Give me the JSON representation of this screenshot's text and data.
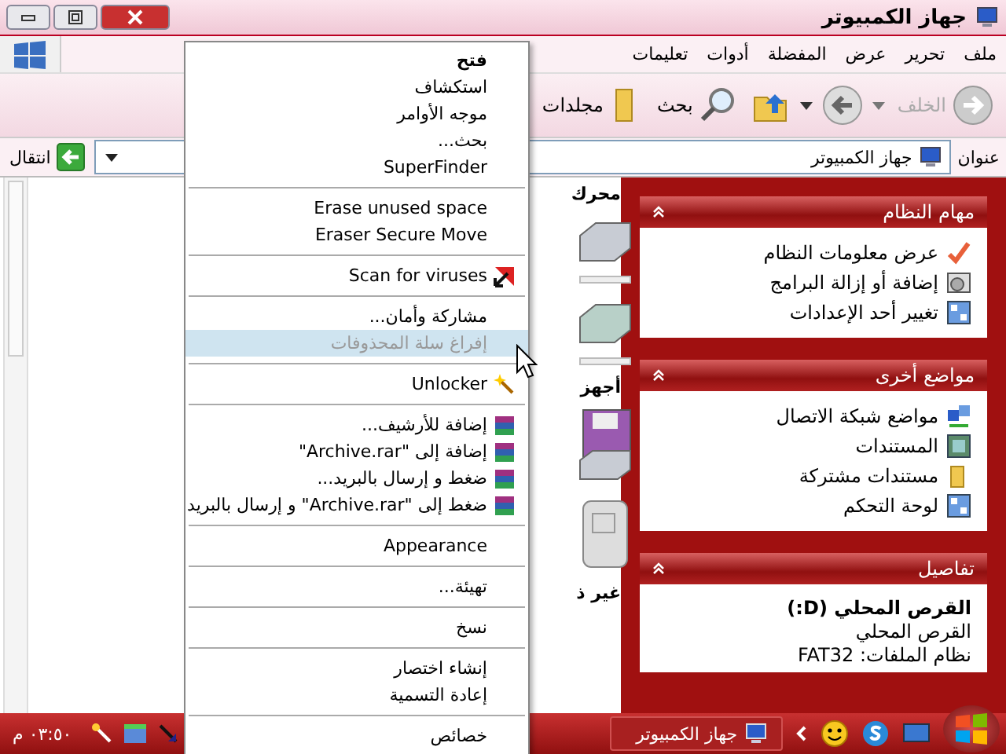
{
  "window": {
    "title": "جهاز الكمبيوتر"
  },
  "menu_bar": [
    "ملف",
    "تحرير",
    "عرض",
    "المفضلة",
    "أدوات",
    "تعليمات"
  ],
  "toolbar": {
    "back": {
      "label": "الخلف",
      "disabled": true
    },
    "search": "بحث",
    "folders": "مجلدات"
  },
  "address_bar": {
    "label": "عنوان",
    "value": "جهاز الكمبيوتر",
    "go": "انتقال"
  },
  "file_area": {
    "group_headers": [
      "محرك",
      "أجهز",
      "غير ذ"
    ]
  },
  "task_panels": [
    {
      "title": "مهام النظام",
      "expanded": true,
      "items": [
        "عرض معلومات النظام",
        "إضافة أو إزالة البرامج",
        "تغيير أحد الإعدادات"
      ]
    },
    {
      "title": "مواضع أخرى",
      "expanded": true,
      "items": [
        "مواضع شبكة الاتصال",
        "المستندات",
        "مستندات مشتركة",
        "لوحة التحكم"
      ]
    }
  ],
  "details": {
    "title": "تفاصيل",
    "expanded": true,
    "name": "القرص المحلي (D:)",
    "type": "القرص المحلي",
    "file_system": "نظام الملفات: FAT32"
  },
  "context_menu": [
    {
      "kind": "item",
      "label": "فتح",
      "default": true,
      "disabled": false,
      "selected": false
    },
    {
      "kind": "item",
      "label": "استكشاف",
      "default": false,
      "disabled": false,
      "selected": false
    },
    {
      "kind": "item",
      "label": "موجه الأوامر",
      "default": false,
      "disabled": false,
      "selected": false
    },
    {
      "kind": "item",
      "label": "بحث...",
      "default": false,
      "disabled": false,
      "selected": false
    },
    {
      "kind": "item",
      "label": "SuperFinder",
      "default": false,
      "disabled": false,
      "selected": false
    },
    {
      "kind": "separator"
    },
    {
      "kind": "item",
      "label": "Erase unused space",
      "default": false,
      "disabled": false,
      "selected": false
    },
    {
      "kind": "item",
      "label": "Eraser Secure Move",
      "default": false,
      "disabled": false,
      "selected": false
    },
    {
      "kind": "separator"
    },
    {
      "kind": "scan",
      "label": "Scan for viruses",
      "default": false,
      "disabled": false,
      "selected": false
    },
    {
      "kind": "separator"
    },
    {
      "kind": "item",
      "label": "مشاركة وأمان...",
      "default": false,
      "disabled": false,
      "selected": false
    },
    {
      "kind": "item",
      "label": "إفراغ سلة المحذوفات",
      "default": false,
      "disabled": true,
      "selected": true
    },
    {
      "kind": "separator"
    },
    {
      "kind": "unlocker",
      "label": "Unlocker",
      "default": false,
      "disabled": false,
      "selected": false
    },
    {
      "kind": "separator"
    },
    {
      "kind": "archive",
      "label": "إضافة للأرشيف...",
      "default": false,
      "disabled": false,
      "selected": false
    },
    {
      "kind": "archive",
      "label": "إضافة إلى \"Archive.rar\"",
      "default": false,
      "disabled": false,
      "selected": false
    },
    {
      "kind": "archive",
      "label": "ضغط و إرسال بالبريد...",
      "default": false,
      "disabled": false,
      "selected": false
    },
    {
      "kind": "archive",
      "label": "ضغط إلى \"Archive.rar\" و إرسال بالبريد",
      "default": false,
      "disabled": false,
      "selected": false
    },
    {
      "kind": "separator"
    },
    {
      "kind": "item",
      "label": "Appearance",
      "default": false,
      "disabled": false,
      "selected": false
    },
    {
      "kind": "separator"
    },
    {
      "kind": "item",
      "label": "تهيئة...",
      "default": false,
      "disabled": false,
      "selected": false
    },
    {
      "kind": "separator"
    },
    {
      "kind": "item",
      "label": "نسخ",
      "default": false,
      "disabled": false,
      "selected": false
    },
    {
      "kind": "separator"
    },
    {
      "kind": "item",
      "label": "إنشاء اختصار",
      "default": false,
      "disabled": false,
      "selected": false
    },
    {
      "kind": "item",
      "label": "إعادة التسمية",
      "default": false,
      "disabled": false,
      "selected": false
    },
    {
      "kind": "separator"
    },
    {
      "kind": "item",
      "label": "خصائص",
      "default": false,
      "disabled": false,
      "selected": false
    }
  ],
  "taskbar": {
    "task": "جهاز الكمبيوتر",
    "clock": "٠٣:٥٠ م"
  }
}
